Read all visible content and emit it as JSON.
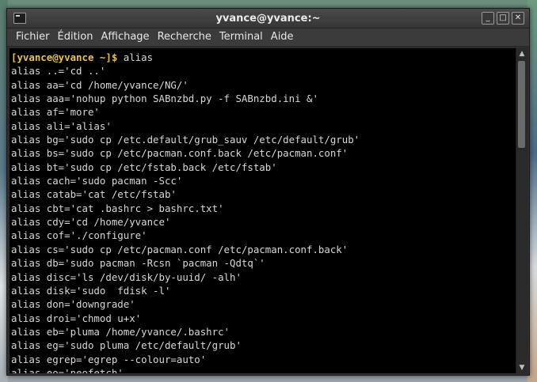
{
  "window": {
    "title": "yvance@yvance:~",
    "controls": {
      "minimize": "_",
      "maximize": "□",
      "close": "✕"
    }
  },
  "menu": [
    "Fichier",
    "Édition",
    "Affichage",
    "Recherche",
    "Terminal",
    "Aide"
  ],
  "terminal": {
    "prompt": "[yvance@yvance ~]$",
    "command": " alias",
    "lines": [
      "alias ..='cd ..'",
      "alias aa='cd /home/yvance/NG/'",
      "alias aaa='nohup python SABnzbd.py -f SABnzbd.ini &'",
      "alias af='more'",
      "alias ali='alias'",
      "alias bg='sudo cp /etc.default/grub_sauv /etc/default/grub'",
      "alias bs='sudo cp /etc/pacman.conf.back /etc/pacman.conf'",
      "alias bt='sudo cp /etc/fstab.back /etc/fstab'",
      "alias cach='sudo pacman -Scc'",
      "alias catab='cat /etc/fstab'",
      "alias cbt='cat .bashrc > bashrc.txt'",
      "alias cdy='cd /home/yvance'",
      "alias cof='./configure'",
      "alias cs='sudo cp /etc/pacman.conf /etc/pacman.conf.back'",
      "alias db='sudo pacman -Rcsn `pacman -Qdtq`'",
      "alias disc='ls /dev/disk/by-uuid/ -alh'",
      "alias disk='sudo  fdisk -l'",
      "alias don='downgrade'",
      "alias droi='chmod u+x'",
      "alias eb='pluma /home/yvance/.bashrc'",
      "alias eg='sudo pluma /etc/default/grub'",
      "alias egrep='egrep --colour=auto'",
      "alias eo='neofetch'"
    ]
  },
  "scrollbar": {
    "up_arrow": "▲",
    "down_arrow": "▼"
  }
}
